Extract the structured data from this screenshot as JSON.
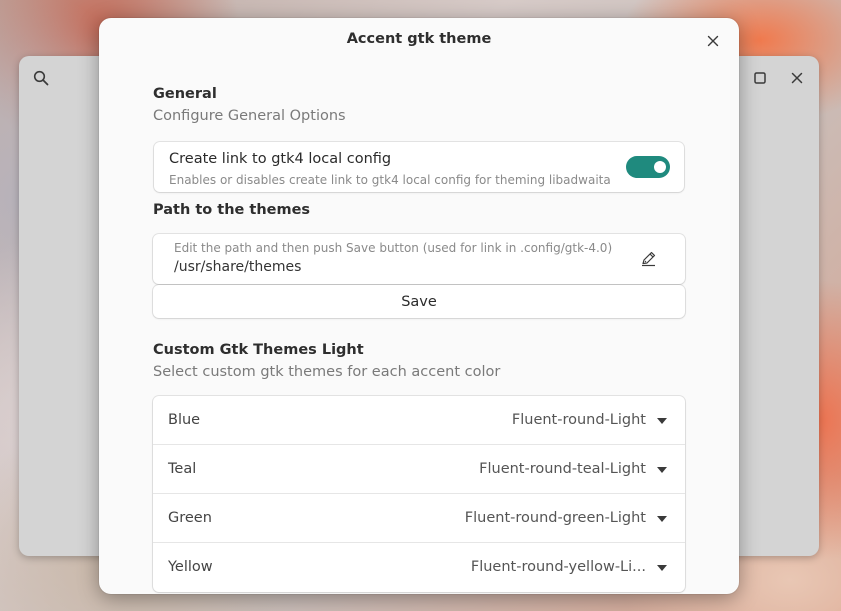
{
  "background_window": {
    "icons": [
      "search-icon",
      "maximize-icon",
      "close-icon"
    ]
  },
  "dialog": {
    "title": "Accent gtk theme",
    "close_icon": "close-icon"
  },
  "general": {
    "title": "General",
    "subtitle": "Configure General Options",
    "link_option": {
      "title": "Create link to gtk4 local config",
      "subtitle": "Enables or disables create link to gtk4 local config for theming libadwaita",
      "enabled": true
    }
  },
  "themes_path": {
    "title": "Path to the themes",
    "hint": "Edit the path and then push Save button (used for link in .config/gtk-4.0)",
    "value": "/usr/share/themes",
    "edit_icon": "edit-icon",
    "save_label": "Save"
  },
  "custom_light": {
    "title": "Custom Gtk Themes Light",
    "subtitle": "Select custom gtk themes for each accent color",
    "rows": [
      {
        "label": "Blue",
        "value": "Fluent-round-Light"
      },
      {
        "label": "Teal",
        "value": "Fluent-round-teal-Light"
      },
      {
        "label": "Green",
        "value": "Fluent-round-green-Light"
      },
      {
        "label": "Yellow",
        "value": "Fluent-round-yellow-Li..."
      }
    ]
  },
  "colors": {
    "accent": "#1f8a7e",
    "dialog_bg": "#fafafa",
    "card_bg": "#ffffff"
  }
}
